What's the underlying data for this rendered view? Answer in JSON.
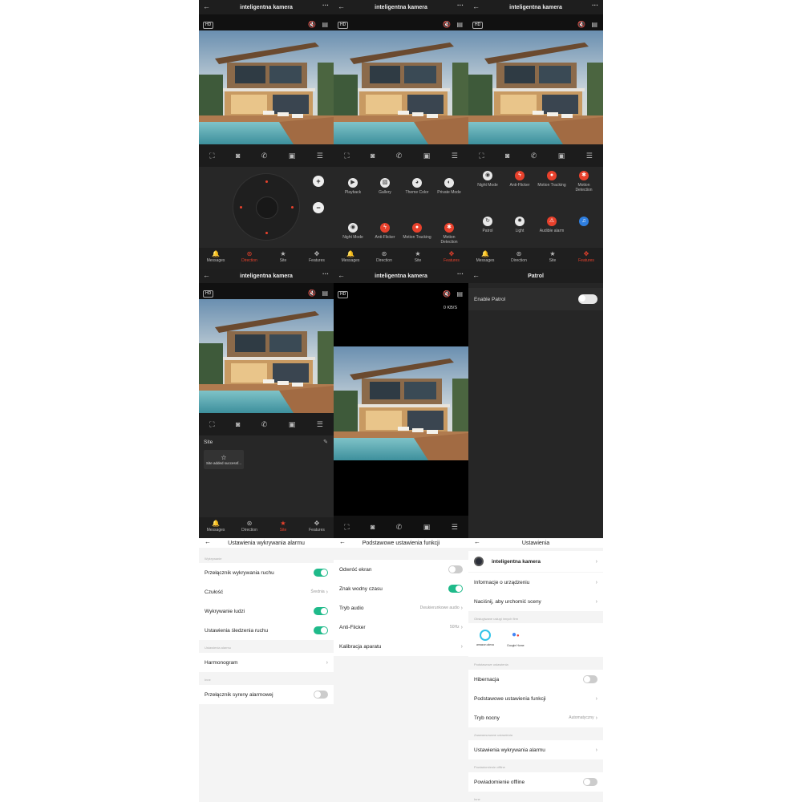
{
  "common": {
    "camera_title": "inteligentna kamera",
    "hd": "HD",
    "more": "···",
    "back": "←",
    "chevron": "›",
    "nav": {
      "messages": "Messages",
      "direction": "Direction",
      "site": "Site",
      "features": "Features"
    }
  },
  "features_page2": {
    "row1": [
      {
        "label": "Playback",
        "icon": "play-icon",
        "style": "w"
      },
      {
        "label": "Gallery",
        "icon": "gallery-icon",
        "style": "w"
      },
      {
        "label": "Theme Color",
        "icon": "palette-icon",
        "style": "w"
      },
      {
        "label": "Private Mode",
        "icon": "shield-icon",
        "style": "w"
      }
    ],
    "row2": [
      {
        "label": "Night Mode",
        "icon": "eye-icon",
        "style": "w"
      },
      {
        "label": "Anti-Flicker",
        "icon": "flash-icon",
        "style": "r"
      },
      {
        "label": "Motion Tracking",
        "icon": "pin-icon",
        "style": "r"
      },
      {
        "label": "Motion Detection",
        "icon": "motion-icon",
        "style": "r"
      }
    ]
  },
  "features_page3": {
    "row1": [
      {
        "label": "Night Mode",
        "icon": "eye-icon",
        "style": "w"
      },
      {
        "label": "Anti-Flicker",
        "icon": "flash-icon",
        "style": "r"
      },
      {
        "label": "Motion Tracking",
        "icon": "pin-icon",
        "style": "r"
      },
      {
        "label": "Motion Detection",
        "icon": "motion-icon",
        "style": "r"
      }
    ],
    "row2": [
      {
        "label": "Patrol",
        "icon": "patrol-icon",
        "style": "w"
      },
      {
        "label": "Light",
        "icon": "light-icon",
        "style": "w"
      },
      {
        "label": "Audible alarm",
        "icon": "alarm-icon",
        "style": "r"
      },
      {
        "label": "",
        "icon": "cry-icon",
        "style": "b"
      }
    ]
  },
  "site_panel": {
    "title": "Site",
    "card_text": "Site added successf..."
  },
  "fullscreen": {
    "speed": "0 KB/S"
  },
  "patrol": {
    "title": "Patrol",
    "enable_label": "Enable Patrol",
    "enabled": false
  },
  "alarm_settings": {
    "title": "Ustawienia wykrywania alarmu",
    "section1": "Wykrywanie",
    "rows1": [
      {
        "label": "Przełącznik wykrywania ruchu",
        "type": "toggle",
        "on": true
      },
      {
        "label": "Czułość",
        "type": "value",
        "value": "Średnia"
      },
      {
        "label": "Wykrywanie ludzi",
        "type": "toggle",
        "on": true
      },
      {
        "label": "Ustawienia śledzenia ruchu",
        "type": "toggle",
        "on": true
      }
    ],
    "section2": "Ustawienia alarmu",
    "schedule": "Harmonogram",
    "section3": "Inne",
    "siren": "Przełącznik syreny alarmowej",
    "siren_on": false
  },
  "basic_settings": {
    "title": "Podstawowe ustawienia funkcji",
    "rows": [
      {
        "label": "Odwróć ekran",
        "type": "toggle",
        "on": false
      },
      {
        "label": "Znak wodny czasu",
        "type": "toggle",
        "on": true
      },
      {
        "label": "Tryb audio",
        "type": "value",
        "value": "Dwukierunkowe audio"
      },
      {
        "label": "Anti-Flicker",
        "type": "value",
        "value": "50Hz"
      },
      {
        "label": "Kalibracja aparatu",
        "type": "chevron"
      }
    ]
  },
  "settings": {
    "title": "Ustawienia",
    "device_name": "inteligentna kamera",
    "info": "Informacje o urządzeniu",
    "scene": "Naciśnij, aby urchomić sceny",
    "section_services": "Obsługiwane usługi innych firm",
    "alexa": "amazon alexa",
    "google": "Google Home",
    "section_basic": "Podstawowe ustawienia",
    "hibernation": "Hibernacja",
    "basic_functions": "Podstawowe ustawienia funkcji",
    "night_mode": "Tryb nocny",
    "night_value": "Automatyczny",
    "section_advanced": "Zaawansowane ustawienia",
    "alarm": "Ustawienia wykrywania alarmu",
    "section_offline": "Powiadomienie offline",
    "offline": "Powiadomienie offline",
    "section_other": "Inne"
  },
  "colors": {
    "accent": "#e8412c",
    "toggle_on": "#1fba8a",
    "dark_bg": "#272727"
  }
}
